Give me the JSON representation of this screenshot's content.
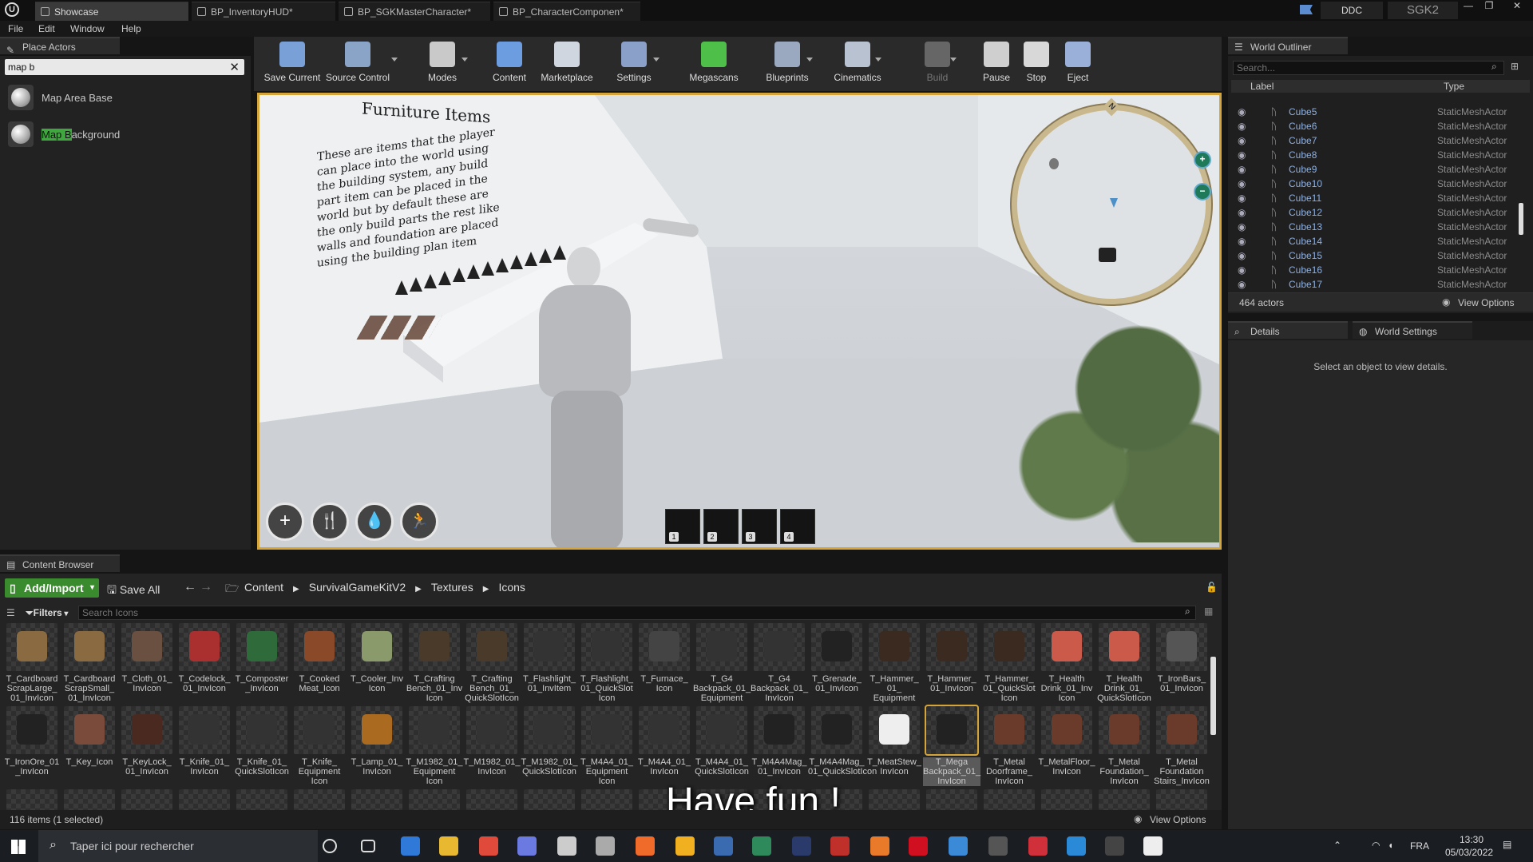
{
  "titlebar": {
    "tabs": [
      "Showcase",
      "BP_InventoryHUD*",
      "BP_SGKMasterCharacter*",
      "BP_CharacterComponen*"
    ],
    "ddc": "DDC",
    "project": "SGK2"
  },
  "menu": [
    "File",
    "Edit",
    "Window",
    "Help"
  ],
  "place_actors": {
    "title": "Place Actors",
    "search_value": "map b",
    "results": [
      "Map Area Base",
      "Map Background"
    ],
    "highlight": "Map B",
    "highlight_rest": "ackground"
  },
  "toolbar": [
    {
      "label": "Save Current",
      "color": "#7aa0d8"
    },
    {
      "label": "Source Control",
      "color": "#8aa4c8"
    },
    {
      "label": "Modes",
      "color": "#c9c9c9"
    },
    {
      "label": "Content",
      "color": "#6c9de0"
    },
    {
      "label": "Marketplace",
      "color": "#d0d6e0"
    },
    {
      "label": "Settings",
      "color": "#8aa0c8"
    },
    {
      "label": "Megascans",
      "color": "#4ec04a"
    },
    {
      "label": "Blueprints",
      "color": "#9aa8c0"
    },
    {
      "label": "Cinematics",
      "color": "#b8c2d0"
    },
    {
      "label": "Build",
      "color": "#666"
    },
    {
      "label": "Pause",
      "color": "#cfcfcf"
    },
    {
      "label": "Stop",
      "color": "#d8d8d8"
    },
    {
      "label": "Eject",
      "color": "#9ab0d8"
    }
  ],
  "viewport": {
    "sign_title": "Furniture Items",
    "sign_text": "These are items that the player can place into the world using the building system, any build part item can be placed in the world but by default these are the only build parts the rest like walls and foundation are placed using the building plan item",
    "hud_buttons": [
      "+",
      "🍴",
      "💧",
      "🏃"
    ],
    "slots": [
      "1",
      "2",
      "3",
      "4"
    ],
    "minimap_north": "N"
  },
  "outliner": {
    "title": "World Outliner",
    "search_placeholder": "Search...",
    "col_label": "Label",
    "col_type": "Type",
    "rows": [
      {
        "label": "Cube5",
        "type": "StaticMeshActor"
      },
      {
        "label": "Cube6",
        "type": "StaticMeshActor"
      },
      {
        "label": "Cube7",
        "type": "StaticMeshActor"
      },
      {
        "label": "Cube8",
        "type": "StaticMeshActor"
      },
      {
        "label": "Cube9",
        "type": "StaticMeshActor"
      },
      {
        "label": "Cube10",
        "type": "StaticMeshActor"
      },
      {
        "label": "Cube11",
        "type": "StaticMeshActor"
      },
      {
        "label": "Cube12",
        "type": "StaticMeshActor"
      },
      {
        "label": "Cube13",
        "type": "StaticMeshActor"
      },
      {
        "label": "Cube14",
        "type": "StaticMeshActor"
      },
      {
        "label": "Cube15",
        "type": "StaticMeshActor"
      },
      {
        "label": "Cube16",
        "type": "StaticMeshActor"
      },
      {
        "label": "Cube17",
        "type": "StaticMeshActor"
      }
    ],
    "count": "464 actors",
    "view_options": "View Options"
  },
  "details": {
    "tab1": "Details",
    "tab2": "World Settings",
    "empty": "Select an object to view details."
  },
  "content_browser": {
    "title": "Content Browser",
    "add_import": "Add/Import",
    "save_all": "Save All",
    "path": [
      "Content",
      "SurvivalGameKitV2",
      "Textures",
      "Icons"
    ],
    "filters": "Filters",
    "search_placeholder": "Search Icons",
    "status": "116 items (1 selected)",
    "view_options": "View Options",
    "overlay": "Have fun !",
    "row1": [
      "T_Cardboard ScrapLarge_ 01_InvIcon",
      "T_Cardboard ScrapSmall_ 01_InvIcon",
      "T_Cloth_01_ InvIcon",
      "T_Codelock_ 01_InvIcon",
      "T_Composter _InvIcon",
      "T_Cooked Meat_Icon",
      "T_Cooler_Inv Icon",
      "T_Crafting Bench_01_Inv Icon",
      "T_Crafting Bench_01_ QuickSlotIcon",
      "T_Flashlight_ 01_InvItem",
      "T_Flashlight_ 01_QuickSlot Icon",
      "T_Furnace_ Icon",
      "T_G4 Backpack_01_ Equipment",
      "T_G4 Backpack_01_ InvIcon",
      "T_Grenade_ 01_InvIcon",
      "T_Hammer_ 01_ Equipment",
      "T_Hammer_ 01_InvIcon",
      "T_Hammer_ 01_QuickSlot Icon",
      "T_Health Drink_01_Inv Icon",
      "T_Health Drink_01_ QuickSlotIcon",
      "T_IronBars_ 01_InvIcon"
    ],
    "row2": [
      "T_IronOre_01 _InvIcon",
      "T_Key_Icon",
      "T_KeyLock_ 01_InvIcon",
      "T_Knife_01_ InvIcon",
      "T_Knife_01_ QuickSlotIcon",
      "T_Knife_ Equipment Icon",
      "T_Lamp_01_ InvIcon",
      "T_M1982_01_ Equipment Icon",
      "T_M1982_01_ InvIcon",
      "T_M1982_01_ QuickSlotIcon",
      "T_M4A4_01_ Equipment Icon",
      "T_M4A4_01_ InvIcon",
      "T_M4A4_01_ QuickSlotIcon",
      "T_M4A4Mag_ 01_InvIcon",
      "T_M4A4Mag_ 01_QuickSlotIcon",
      "T_MeatStew_ InvIcon",
      "T_Mega Backpack_01_ InvIcon",
      "T_Metal Doorframe_ InvIcon",
      "T_MetalFloor_ InvIcon",
      "T_Metal Foundation_ InvIcon",
      "T_Metal Foundation Stairs_InvIcon"
    ]
  },
  "taskbar": {
    "search": "Taper ici pour rechercher",
    "lang": "FRA",
    "time": "13:30",
    "date": "05/03/2022"
  }
}
